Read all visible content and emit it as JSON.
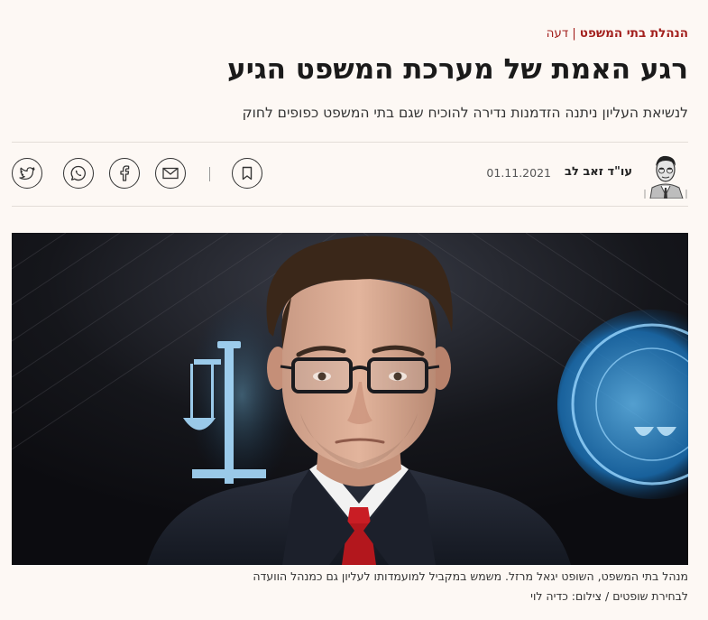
{
  "breadcrumb": {
    "category": "הנהלת בתי המשפט",
    "separator": "|",
    "section": "דעה"
  },
  "article": {
    "title": "רגע האמת של מערכת המשפט הגיע",
    "subtitle": "לנשיאת העליון ניתנה הזדמנות נדירה להוכיח שגם בתי המשפט כפופים לחוק"
  },
  "byline": {
    "author": "עו\"ד זאב לב",
    "date": "01.11.2021"
  },
  "share": {
    "icons": [
      "bookmark-icon",
      "mail-icon",
      "facebook-icon",
      "whatsapp-icon",
      "twitter-icon"
    ]
  },
  "photo": {
    "caption_line1": "מנהל בתי המשפט, השופט יגאל מרזל. משמש במקביל למועמדותו לעליון גם כמנהל הוועדה",
    "caption_line2": "לבחירת שופטים / צילום: כדיה לוי"
  },
  "colors": {
    "accent": "#a3211e",
    "background": "#fdf8f4"
  }
}
